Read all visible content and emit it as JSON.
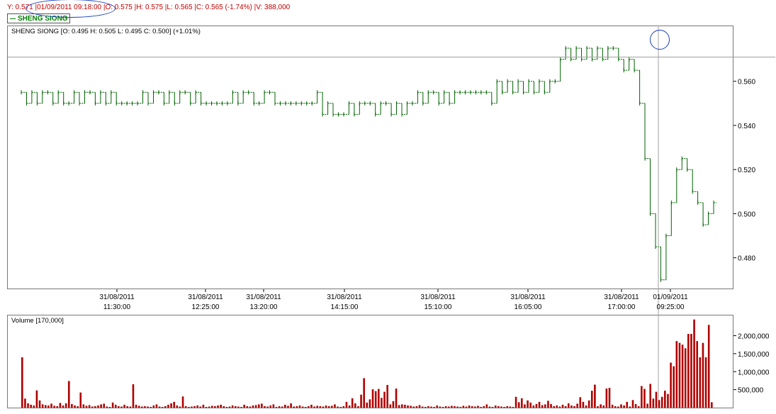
{
  "header": {
    "info_line": "Y: 0.571 |01/09/2011 09:18:00 |O: 0.575 |H: 0.575 |L: 0.565 |C: 0.565 (-1.74%) |V: 388,000",
    "legend_label": "SHENG SIONG"
  },
  "price_panel": {
    "title": "SHENG SIONG [O: 0.495  H: 0.505  L: 0.495  C: 0.500] (+1.01%)"
  },
  "volume_panel": {
    "title": "Volume [170,000]"
  },
  "colors": {
    "price_line": "#006400",
    "volume_bar": "#b00000",
    "crosshair": "#a0a0a0",
    "annotation": "#1a3fbf"
  },
  "chart_data": [
    {
      "type": "line",
      "series": [
        {
          "name": "SHENG SIONG",
          "values": [
            0.555,
            0.55,
            0.555,
            0.55,
            0.555,
            0.555,
            0.55,
            0.555,
            0.55,
            0.55,
            0.555,
            0.55,
            0.555,
            0.555,
            0.55,
            0.555,
            0.55,
            0.555,
            0.55,
            0.55,
            0.55,
            0.55,
            0.55,
            0.555,
            0.55,
            0.555,
            0.555,
            0.55,
            0.555,
            0.55,
            0.555,
            0.555,
            0.55,
            0.555,
            0.55,
            0.55,
            0.55,
            0.55,
            0.55,
            0.55,
            0.555,
            0.55,
            0.555,
            0.555,
            0.55,
            0.55,
            0.555,
            0.555,
            0.55,
            0.55,
            0.55,
            0.55,
            0.55,
            0.55,
            0.55,
            0.55,
            0.555,
            0.545,
            0.55,
            0.545,
            0.545,
            0.545,
            0.55,
            0.545,
            0.55,
            0.55,
            0.55,
            0.545,
            0.55,
            0.55,
            0.545,
            0.55,
            0.545,
            0.55,
            0.55,
            0.555,
            0.55,
            0.555,
            0.555,
            0.55,
            0.555,
            0.55,
            0.555,
            0.555,
            0.555,
            0.555,
            0.555,
            0.555,
            0.555,
            0.55,
            0.56,
            0.555,
            0.56,
            0.555,
            0.56,
            0.555,
            0.56,
            0.555,
            0.56,
            0.555,
            0.56,
            0.56,
            0.57,
            0.575,
            0.57,
            0.575,
            0.57,
            0.575,
            0.57,
            0.575,
            0.57,
            0.575,
            0.575,
            0.57,
            0.565,
            0.57,
            0.565,
            0.55,
            0.525,
            0.5,
            0.485,
            0.47,
            0.49,
            0.505,
            0.52,
            0.525,
            0.52,
            0.51,
            0.505,
            0.495,
            0.5,
            0.505
          ]
        }
      ],
      "y_ticks": [
        "0.480",
        "0.500",
        "0.520",
        "0.540",
        "0.560"
      ],
      "ylim": [
        0.468,
        0.58
      ],
      "x_ticks": [
        {
          "date": "31/08/2011",
          "time": "11:30:00"
        },
        {
          "date": "31/08/2011",
          "time": "12:25:00"
        },
        {
          "date": "31/08/2011",
          "time": "13:20:00"
        },
        {
          "date": "31/08/2011",
          "time": "14:15:00"
        },
        {
          "date": "31/08/2011",
          "time": "15:10:00"
        },
        {
          "date": "31/08/2011",
          "time": "16:05:00"
        },
        {
          "date": "31/08/2011",
          "time": "17:00:00"
        },
        {
          "date": "01/09/2011",
          "time": "09:25:00"
        }
      ],
      "crosshair_y": 0.571
    },
    {
      "type": "bar",
      "series": [
        {
          "name": "Volume",
          "values": [
            1400000,
            250000,
            120000,
            80000,
            60000,
            480000,
            200000,
            90000,
            70000,
            60000,
            110000,
            50000,
            40000,
            130000,
            60000,
            120000,
            740000,
            100000,
            60000,
            40000,
            420000,
            90000,
            50000,
            70000,
            30000,
            40000,
            60000,
            90000,
            110000,
            30000,
            20000,
            140000,
            80000,
            40000,
            30000,
            80000,
            40000,
            30000,
            650000,
            80000,
            50000,
            30000,
            40000,
            30000,
            20000,
            60000,
            90000,
            30000,
            20000,
            40000,
            80000,
            120000,
            160000,
            60000,
            30000,
            310000,
            40000,
            20000,
            30000,
            40000,
            60000,
            30000,
            80000,
            20000,
            30000,
            50000,
            40000,
            60000,
            80000,
            40000,
            20000,
            30000,
            60000,
            40000,
            30000,
            20000,
            80000,
            40000,
            30000,
            60000,
            70000,
            90000,
            110000,
            40000,
            30000,
            60000,
            90000,
            20000,
            40000,
            30000,
            80000,
            50000,
            120000,
            30000,
            40000,
            60000,
            30000,
            20000,
            40000,
            80000,
            30000,
            50000,
            40000,
            30000,
            60000,
            40000,
            50000,
            90000,
            30000,
            20000,
            40000,
            160000,
            60000,
            260000,
            120000,
            40000,
            360000,
            820000,
            140000,
            230000,
            510000,
            460000,
            520000,
            270000,
            440000,
            630000,
            90000,
            180000,
            530000,
            70000,
            90000,
            80000,
            60000,
            50000,
            30000,
            40000,
            70000,
            30000,
            20000,
            40000,
            30000,
            20000,
            60000,
            30000,
            20000,
            40000,
            30000,
            50000,
            40000,
            30000,
            20000,
            50000,
            30000,
            60000,
            40000,
            30000,
            50000,
            20000,
            40000,
            90000,
            30000,
            20000,
            60000,
            40000,
            30000,
            20000,
            40000,
            30000,
            20000,
            300000,
            150000,
            260000,
            90000,
            200000,
            140000,
            60000,
            100000,
            160000,
            70000,
            90000,
            190000,
            100000,
            40000,
            60000,
            30000,
            80000,
            40000,
            120000,
            60000,
            40000,
            110000,
            290000,
            160000,
            60000,
            200000,
            470000,
            640000,
            40000,
            90000,
            60000,
            530000,
            550000,
            80000,
            40000,
            30000,
            90000,
            60000,
            160000,
            30000,
            210000,
            100000,
            40000,
            600000,
            520000,
            110000,
            660000,
            250000,
            440000,
            210000,
            300000,
            470000,
            380000,
            1250000,
            1150000,
            1850000,
            1800000,
            1750000,
            1650000,
            2050000,
            2050000,
            2450000,
            1850000,
            1400000,
            1800000,
            1400000,
            2300000,
            150000
          ]
        }
      ],
      "y_ticks": [
        "500,000",
        "1,000,000",
        "1,500,000",
        "2,000,000"
      ],
      "ylim": [
        0,
        2550000
      ]
    }
  ]
}
